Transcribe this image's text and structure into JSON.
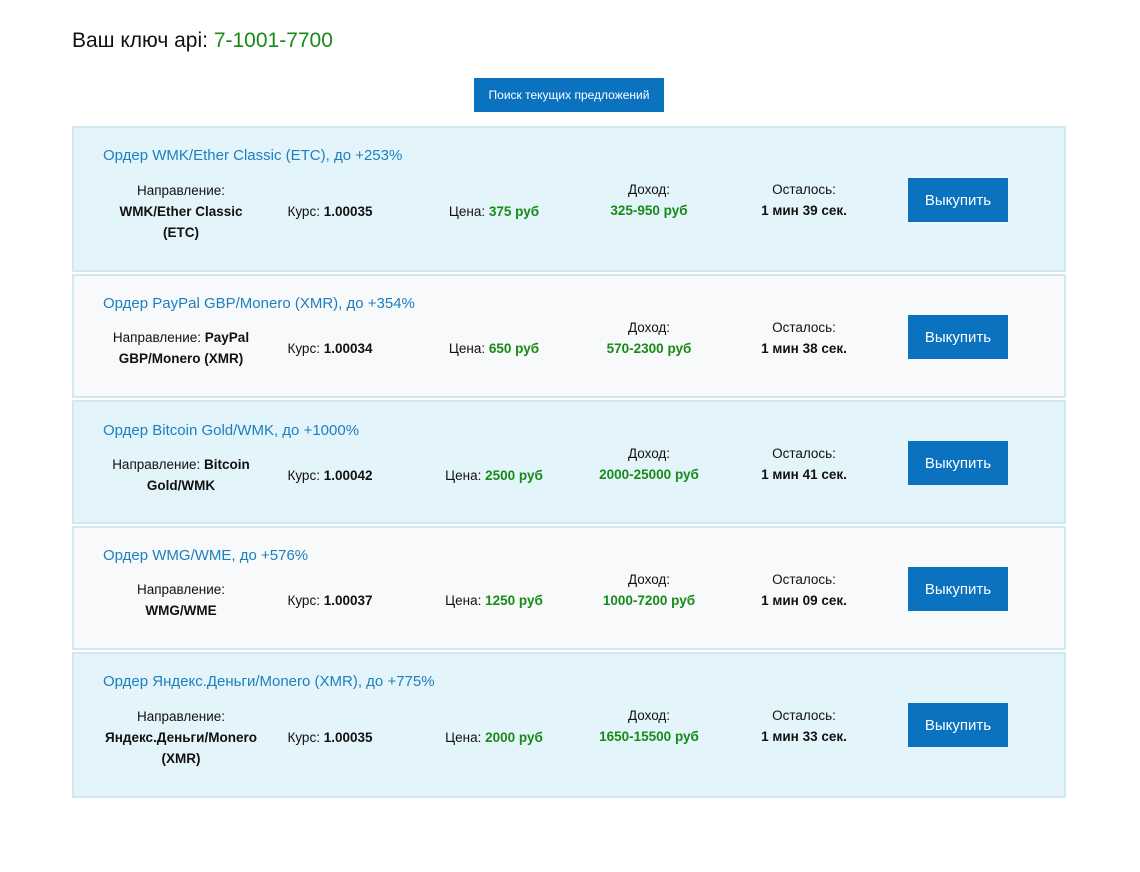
{
  "header": {
    "api_label": "Ваш ключ api:",
    "api_key": "7-1001-7700"
  },
  "search_button": "Поиск текущих предложений",
  "labels": {
    "direction": "Направление:",
    "rate": "Курс:",
    "price": "Цена:",
    "income": "Доход:",
    "remaining": "Осталось:",
    "buy": "Выкупить"
  },
  "orders": [
    {
      "title": "Ордер WMK/Ether Classic (ETC), до +253%",
      "direction": "WMK/Ether Classic (ETC)",
      "rate": "1.00035",
      "price": "375 руб",
      "income": "325-950 руб",
      "remaining": "1 мин 39 сек."
    },
    {
      "title": "Ордер PayPal GBP/Monero (XMR), до +354%",
      "direction": "PayPal GBP/Monero (XMR)",
      "rate": "1.00034",
      "price": "650 руб",
      "income": "570-2300 руб",
      "remaining": "1 мин 38 сек."
    },
    {
      "title": "Ордер Bitcoin Gold/WMK, до +1000%",
      "direction": "Bitcoin Gold/WMK",
      "rate": "1.00042",
      "price": "2500 руб",
      "income": "2000-25000 руб",
      "remaining": "1 мин 41 сек."
    },
    {
      "title": "Ордер WMG/WME, до +576%",
      "direction": "WMG/WME",
      "rate": "1.00037",
      "price": "1250 руб",
      "income": "1000-7200 руб",
      "remaining": "1 мин 09 сек."
    },
    {
      "title": "Ордер Яндекс.Деньги/Monero (XMR), до +775%",
      "direction": "Яндекс.Деньги/Monero (XMR)",
      "rate": "1.00035",
      "price": "2000 руб",
      "income": "1650-15500 руб",
      "remaining": "1 мин 33 сек."
    }
  ],
  "colors": {
    "accent": "#0b72c0",
    "link": "#1c7fbf",
    "green": "#178a17",
    "row_blue": "#e4f4fb",
    "row_grey": "#f8f9fa"
  }
}
